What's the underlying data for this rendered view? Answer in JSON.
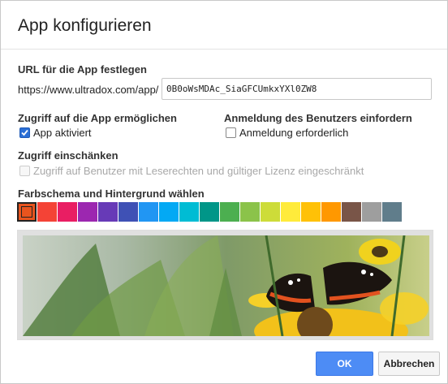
{
  "dialog": {
    "title": "App konfigurieren"
  },
  "url": {
    "heading": "URL für die App festlegen",
    "prefix": "https://www.ultradox.com/app/",
    "value": "0B0oWsMDAc_SiaGFCUmkxYXl0ZW8"
  },
  "access": {
    "heading": "Zugriff auf die App ermöglichen",
    "checkbox_label": "App aktiviert",
    "checked": true
  },
  "login": {
    "heading": "Anmeldung des Benutzers einfordern",
    "checkbox_label": "Anmeldung erforderlich",
    "checked": false
  },
  "restrict": {
    "heading": "Zugriff einschänken",
    "checkbox_label": "Zugriff auf Benutzer mit Leserechten und gültiger Lizenz eingeschränkt",
    "checked": false,
    "disabled": true
  },
  "scheme": {
    "heading": "Farbschema und Hintergrund wählen",
    "colors": [
      "#e8541e",
      "#f44336",
      "#e91e63",
      "#9c27b0",
      "#673ab7",
      "#3f51b5",
      "#2196f3",
      "#03a9f4",
      "#00bcd4",
      "#009688",
      "#4caf50",
      "#8bc34a",
      "#cddc39",
      "#ffeb3b",
      "#ffc107",
      "#ff9800",
      "#795548",
      "#9e9e9e",
      "#607d8b"
    ],
    "selected_index": 0
  },
  "buttons": {
    "ok": "OK",
    "cancel": "Abbrechen",
    "ok_color": "#4d8cf5"
  }
}
